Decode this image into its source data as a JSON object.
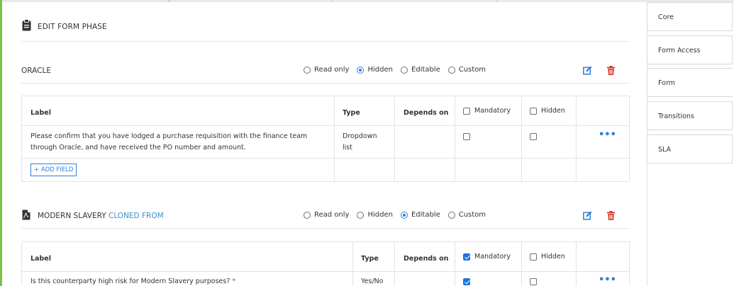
{
  "page": {
    "title": "EDIT FORM PHASE"
  },
  "phases": [
    {
      "name": "ORACLE",
      "cloned_label": "",
      "permissions": {
        "options": [
          "Read only",
          "Hidden",
          "Editable",
          "Custom"
        ],
        "selected": "Hidden"
      },
      "columns": {
        "label": "Label",
        "type": "Type",
        "depends_on": "Depends on",
        "mandatory": "Mandatory",
        "hidden": "Hidden"
      },
      "header_checks": {
        "mandatory": false,
        "hidden": false
      },
      "fields": [
        {
          "label_line1": "Please confirm that you have lodged a purchase requisition with the finance team",
          "label_line2": "through Oracle, and have received the PO number and amount.",
          "type_line1": "Dropdown",
          "type_line2": "list",
          "depends_on": "",
          "mandatory": false,
          "hidden": false,
          "required": false
        }
      ],
      "add_field_label": "+ ADD FIELD"
    },
    {
      "name": "MODERN SLAVERY",
      "cloned_label": "CLONED FROM",
      "permissions": {
        "options": [
          "Read only",
          "Hidden",
          "Editable",
          "Custom"
        ],
        "selected": "Editable"
      },
      "columns": {
        "label": "Label",
        "type": "Type",
        "depends_on": "Depends on",
        "mandatory": "Mandatory",
        "hidden": "Hidden"
      },
      "header_checks": {
        "mandatory": true,
        "hidden": false
      },
      "fields": [
        {
          "label_line1": "Is this counterparty high risk for Modern Slavery purposes?",
          "required_mark": "*",
          "type_line1": "Yes/No",
          "depends_on": "",
          "mandatory": true,
          "hidden": false,
          "required": true
        }
      ]
    }
  ],
  "more_glyph": "•••",
  "sidebar": {
    "tabs": [
      {
        "label": "Core",
        "active": false
      },
      {
        "label": "Form Access",
        "active": false
      },
      {
        "label": "Form",
        "active": true
      },
      {
        "label": "Transitions",
        "active": false
      },
      {
        "label": "SLA",
        "active": false
      }
    ]
  },
  "colors": {
    "accent": "#2f7fd6",
    "danger": "#d9342b",
    "left_bar": "#7cc242"
  }
}
